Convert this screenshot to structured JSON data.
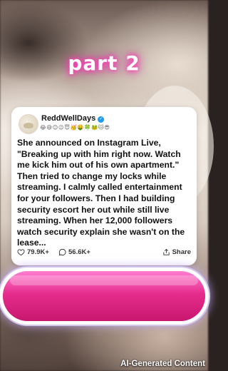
{
  "part_label": "part 2",
  "post": {
    "username": "ReddWellDays",
    "emoji_row": "😂😅😊😉😇🥳🤑🍀🐸🐱😎",
    "text": "She announced on Instagram Live, \"Breaking up with him right now. Watch me kick him out of his own apartment.\" Then tried to change my locks while streaming. I calmly called entertainment for your followers. Then I had building security escort her out while still live streaming. When her 12,000 followers watch security explain she wasn't on the lease...",
    "likes": "79.9K+",
    "comments": "56.6K+",
    "share_label": "Share"
  },
  "footer": {
    "ai_label": "AI-Generated Content"
  },
  "icons": {
    "verified": "verified-badge-icon",
    "like": "heart-icon",
    "comment": "comment-bubble-icon",
    "share": "share-icon"
  },
  "colors": {
    "accent_pink": "#e62d8e",
    "verified_blue": "#1d9bf0"
  }
}
